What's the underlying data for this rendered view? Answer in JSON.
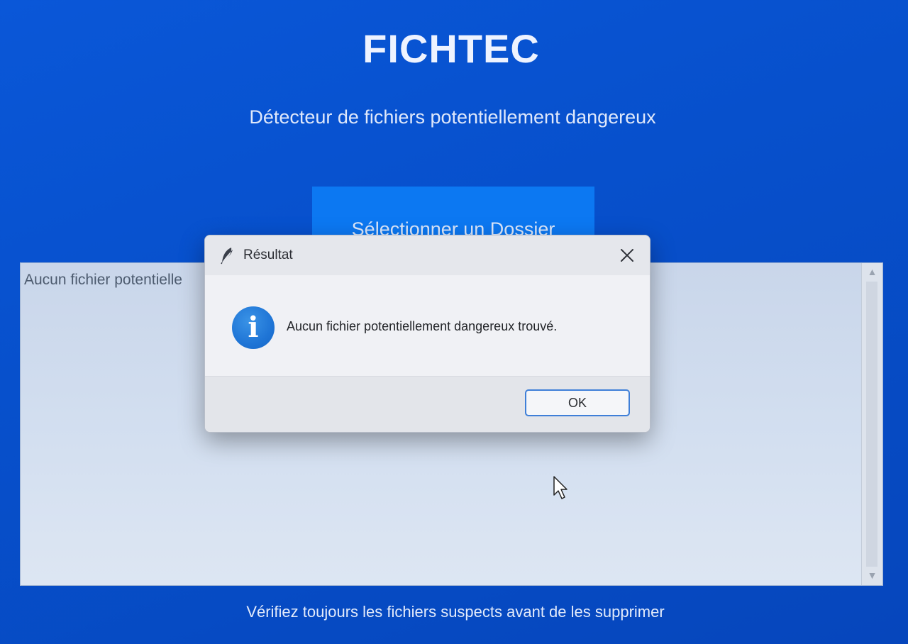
{
  "app": {
    "title": "FICHTEC",
    "subtitle": "Détecteur de fichiers potentiellement dangereux",
    "select_button_label": "Sélectionner un Dossier",
    "results_text": "Aucun fichier potentielle",
    "footer_text": "Vérifiez toujours les fichiers suspects avant de les supprimer"
  },
  "dialog": {
    "title": "Résultat",
    "message": "Aucun fichier potentiellement dangereux trouvé.",
    "ok_label": "OK",
    "info_glyph": "i",
    "icons": {
      "titlebar": "feather-icon",
      "message": "info-icon",
      "close": "close-icon"
    }
  },
  "colors": {
    "background_blue": "#0750cc",
    "button_blue": "#0c78f2",
    "info_icon_blue": "#1f75d6",
    "ok_button_border": "#3f7fd8"
  }
}
